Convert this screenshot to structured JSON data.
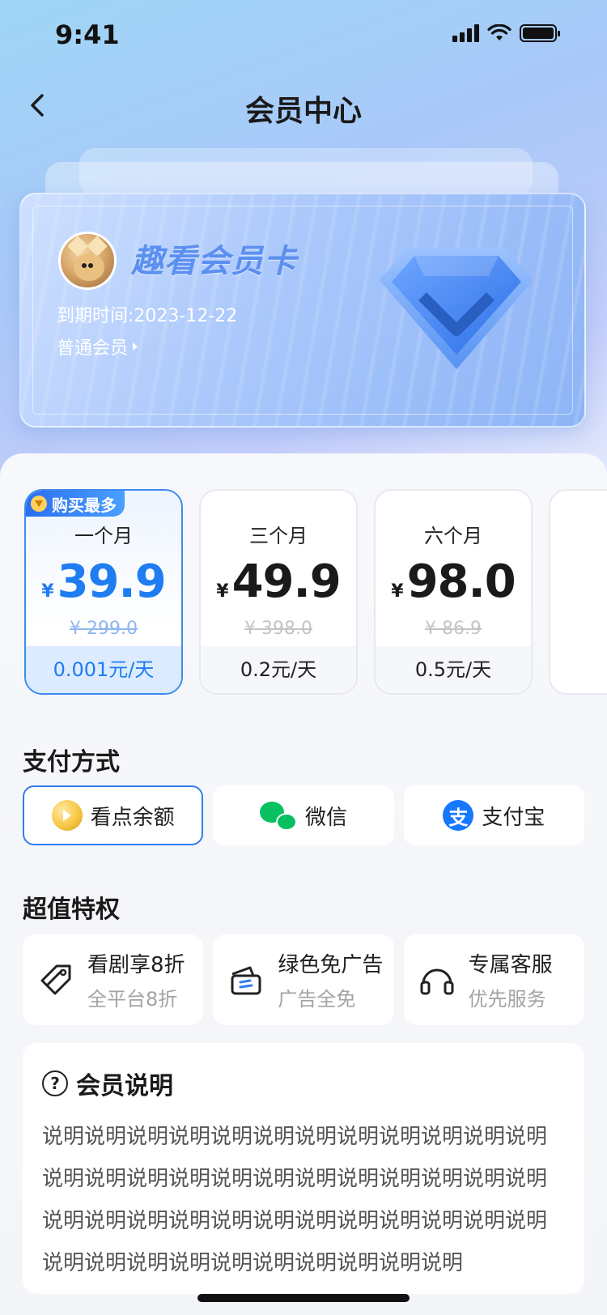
{
  "status_bar": {
    "time": "9:41"
  },
  "nav": {
    "title": "会员中心"
  },
  "member_card": {
    "title": "趣看会员卡",
    "expire_text": "到期时间:2023-12-22",
    "level_text": "普通会员"
  },
  "plans": [
    {
      "badge": "购买最多",
      "name": "一个月",
      "currency": "¥",
      "price": "39.9",
      "original": "¥ 299.0",
      "daily": "0.001元/天",
      "selected": true
    },
    {
      "name": "三个月",
      "currency": "¥",
      "price": "49.9",
      "original": "¥ 398.0",
      "daily": "0.2元/天",
      "selected": false
    },
    {
      "name": "六个月",
      "currency": "¥",
      "price": "98.0",
      "original": "¥ 86.9",
      "daily": "0.5元/天",
      "selected": false
    }
  ],
  "payment": {
    "title": "支付方式",
    "options": [
      {
        "label": "看点余额",
        "icon": "coin-icon",
        "selected": true
      },
      {
        "label": "微信",
        "icon": "wechat-icon",
        "selected": false
      },
      {
        "label": "支付宝",
        "icon": "alipay-icon",
        "selected": false
      }
    ]
  },
  "privileges": {
    "title": "超值特权",
    "items": [
      {
        "title": "看剧享8折",
        "subtitle": "全平台8折",
        "icon": "tag-icon"
      },
      {
        "title": "绿色免广告",
        "subtitle": "广告全免",
        "icon": "ad-free-icon"
      },
      {
        "title": "专属客服",
        "subtitle": "优先服务",
        "icon": "headset-icon"
      }
    ]
  },
  "notes": {
    "title": "会员说明",
    "body": "说明说明说明说明说明说明说明说明说明说明说明说明说明说明说明说明说明说明说明说明说明说明说明说明说明说明说明说明说明说明说明说明说明说明说明说明说明说明说明说明说明说明说明说明说明说明"
  },
  "colors": {
    "accent": "#1f7cf1",
    "card_title": "#5b8ff0",
    "wechat": "#07c160",
    "alipay": "#1677ff"
  }
}
